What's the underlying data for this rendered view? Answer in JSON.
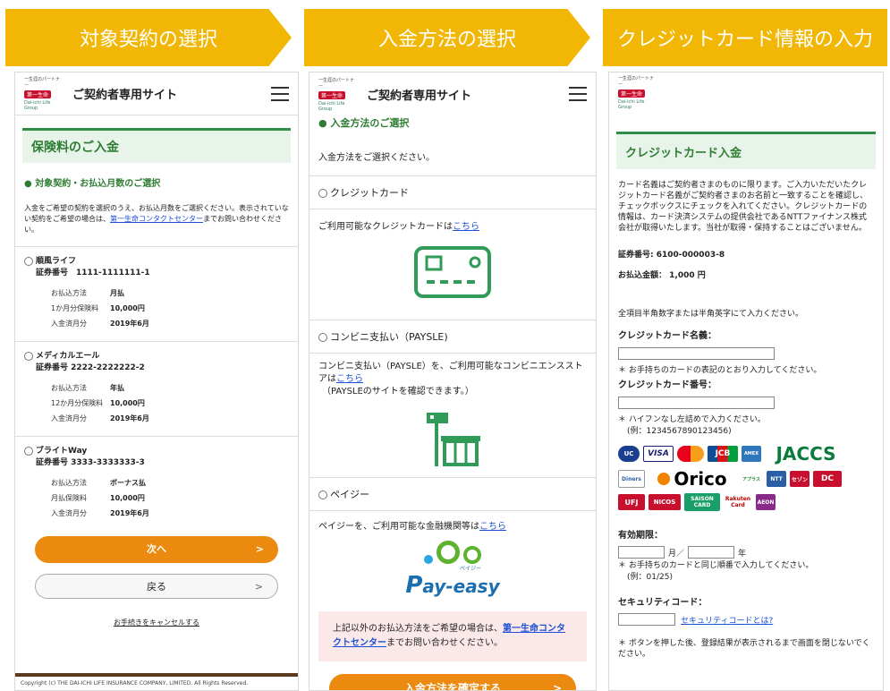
{
  "steps": [
    {
      "label": "対象契約の選択"
    },
    {
      "label": "入金方法の選択"
    },
    {
      "label": "クレジットカード情報の入力"
    }
  ],
  "header": {
    "logo_top": "一生涯のパートナー",
    "logo_mid": "第一生命",
    "logo_sub": "Dai-ichi Life Group",
    "site_title": "ご契約者専用サイト"
  },
  "panel1": {
    "box_title": "保険料のご入金",
    "section_title": "● 対象契約・お払込月数のご選択",
    "intro_before": "入金をご希望の契約を選択のうえ、お払込月数をご選択ください。表示されていない契約をご希望の場合は、",
    "intro_link": "第一生命コンタクトセンター",
    "intro_after": "までお問い合わせください。",
    "contracts": [
      {
        "name": "順風ライフ",
        "policy": "証券番号　1111-1111111-1",
        "rows": [
          [
            "お払込方法",
            "月払"
          ],
          [
            "1か月分保険料",
            "10,000円"
          ],
          [
            "入金済月分",
            "2019年6月"
          ]
        ]
      },
      {
        "name": "メディカルエール",
        "policy": "証券番号 2222-2222222-2",
        "rows": [
          [
            "お払込方法",
            "年払"
          ],
          [
            "12か月分保険料",
            "10,000円"
          ],
          [
            "入金済月分",
            "2019年6月"
          ]
        ]
      },
      {
        "name": "ブライトWay",
        "policy": "証券番号 3333-3333333-3",
        "rows": [
          [
            "お払込方法",
            "ボーナス払"
          ],
          [
            "月払保険料",
            "10,000円"
          ],
          [
            "入金済月分",
            "2019年6月"
          ]
        ]
      }
    ],
    "next": "次へ",
    "back": "戻る",
    "cancel": "お手続きをキャンセルする",
    "copyright": "Copyright (c) THE DAI-ICHI LIFE INSURANCE COMPANY, LIMITED. All Rights Reserved.",
    "arrow": ">"
  },
  "panel2": {
    "section_title": "● 入金方法のご選択",
    "prompt": "入金方法をご選択ください。",
    "credit_label": "クレジットカード",
    "credit_text": "ご利用可能なクレジットカードは",
    "here": "こちら",
    "conv_label": "コンビニ支払い（PAYSLE)",
    "conv_text": "コンビニ支払い（PAYSLE）を、ご利用可能なコンビニエンスストアは",
    "conv_note": "（PAYSLEのサイトを確認できます。）",
    "payeasy_label": "ペイジー",
    "payeasy_text": "ペイジーを、ご利用可能な金融機関等は",
    "payeasy_logo": "ay-easy",
    "payeasy_kana": "ペイジー",
    "other_before": "上記以外のお払込方法をご希望の場合は、",
    "other_link": "第一生命コンタクトセンター",
    "other_after": "までお問い合わせください。",
    "confirm": "入金方法を確定する",
    "arrow": ">"
  },
  "panel3": {
    "box_title": "クレジットカード入金",
    "notice": "カード名義はご契約者さまのものに限ります。ご入力いただいたクレジットカード名義がご契約者さまのお名前と一致することを確認し、チェックボックスにチェックを入れてください。クレジットカードの情報は、カード決済システムの提供会社であるNTTファイナンス株式会社が取得いたします。当社が取得・保持することはございません。",
    "policy": "証券番号: 6100-000003-8",
    "amount": "お払込金額： 1,000 円",
    "instruction": "全項目半角数字または半角英字にて入力ください。",
    "name_label": "クレジットカード名義：",
    "name_hint": "＊ お手持ちのカードの表記のとおり入力してください。",
    "number_label": "クレジットカード番号：",
    "number_hint": "＊ ハイフンなし左詰めで入力ください。",
    "number_example": "(例：1234567890123456)",
    "expiry_label": "有効期限：",
    "month": "月／",
    "year": "年",
    "expiry_hint": "＊ お手持ちのカードと同じ順番で入力してください。",
    "expiry_example": "(例：01/25)",
    "cvc_label": "セキュリティコード：",
    "cvc_link": "セキュリティコードとは?",
    "footer_note": "＊ ボタンを押した後、登録結果が表示されるまで画面を閉じないでください。",
    "brands": [
      "UC",
      "VISA",
      "MC",
      "JCB",
      "AMEX",
      "JACCS",
      "Diners",
      "Orico",
      "アプラス",
      "NTT",
      "セゾン",
      "DC",
      "UFJ",
      "NICOS",
      "SAISON CARD",
      "Rakuten Card",
      "AEON"
    ]
  },
  "colors": {
    "banner": "#f2b705",
    "accent_green": "#2e7d32",
    "button_orange": "#ec8a0f",
    "link": "#1a4fd6"
  }
}
